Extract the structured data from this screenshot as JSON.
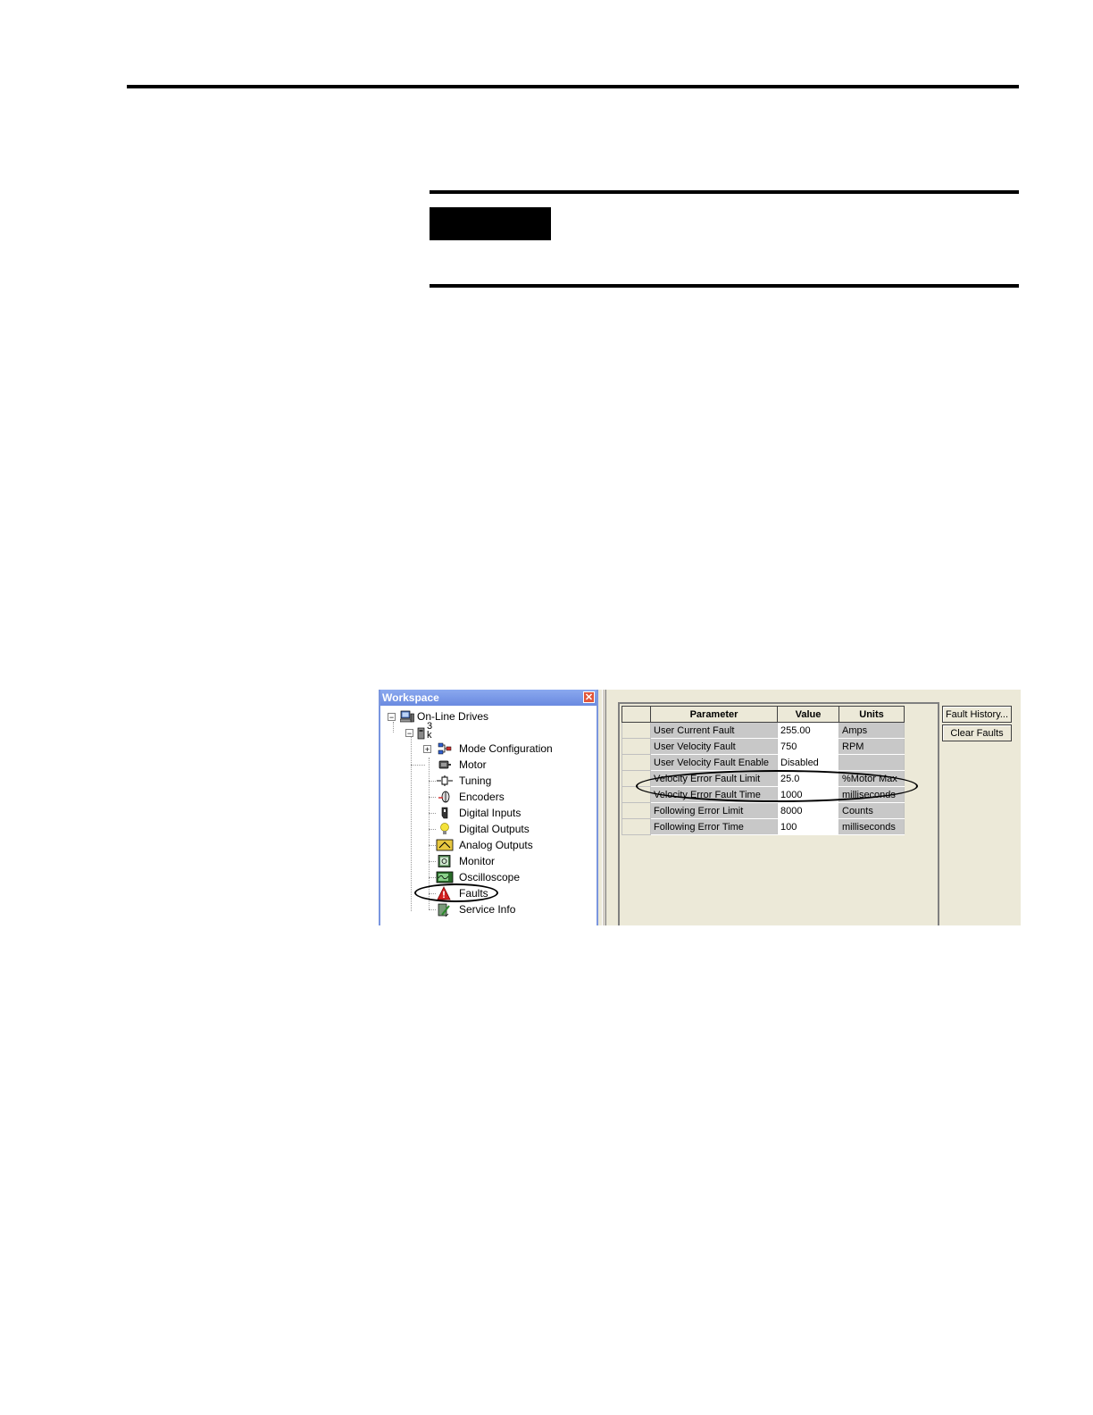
{
  "workspace": {
    "title": "Workspace",
    "close_glyph": "✕",
    "tree": {
      "root": {
        "label": "On-Line Drives",
        "expander": "−"
      },
      "drive": {
        "label_top": "3",
        "label_bottom": "k",
        "expander": "−"
      },
      "items": [
        {
          "label": "Mode Configuration",
          "icon": "mode-configuration-icon",
          "expander": "+"
        },
        {
          "label": "Motor",
          "icon": "motor-icon"
        },
        {
          "label": "Tuning",
          "icon": "tuning-icon"
        },
        {
          "label": "Encoders",
          "icon": "encoders-icon"
        },
        {
          "label": "Digital Inputs",
          "icon": "digital-inputs-icon"
        },
        {
          "label": "Digital Outputs",
          "icon": "light-bulb-icon"
        },
        {
          "label": "Analog Outputs",
          "icon": "analog-outputs-icon"
        },
        {
          "label": "Monitor",
          "icon": "monitor-icon"
        },
        {
          "label": "Oscilloscope",
          "icon": "oscilloscope-icon"
        },
        {
          "label": "Faults",
          "icon": "warning-triangle-icon"
        },
        {
          "label": "Service Info",
          "icon": "service-info-icon"
        }
      ]
    }
  },
  "grid": {
    "headers": {
      "parameter": "Parameter",
      "value": "Value",
      "units": "Units"
    },
    "rows": [
      {
        "parameter": "User Current Fault",
        "value": "255.00",
        "units": "Amps"
      },
      {
        "parameter": "User Velocity Fault",
        "value": "750",
        "units": "RPM"
      },
      {
        "parameter": "User Velocity Fault Enable",
        "value": "Disabled",
        "units": ""
      },
      {
        "parameter": "Velocity Error Fault Limit",
        "value": "25.0",
        "units": "%Motor Max"
      },
      {
        "parameter": "Velocity Error Fault Time",
        "value": "1000",
        "units": "milliseconds"
      },
      {
        "parameter": "Following Error Limit",
        "value": "8000",
        "units": "Counts"
      },
      {
        "parameter": "Following Error Time",
        "value": "100",
        "units": "milliseconds"
      }
    ]
  },
  "buttons": {
    "fault_history": "Fault History...",
    "clear_faults": "Clear Faults"
  },
  "colors": {
    "title_bar": "#7a96df",
    "panel_bg": "#ece9d8",
    "warning": "#d42020"
  }
}
